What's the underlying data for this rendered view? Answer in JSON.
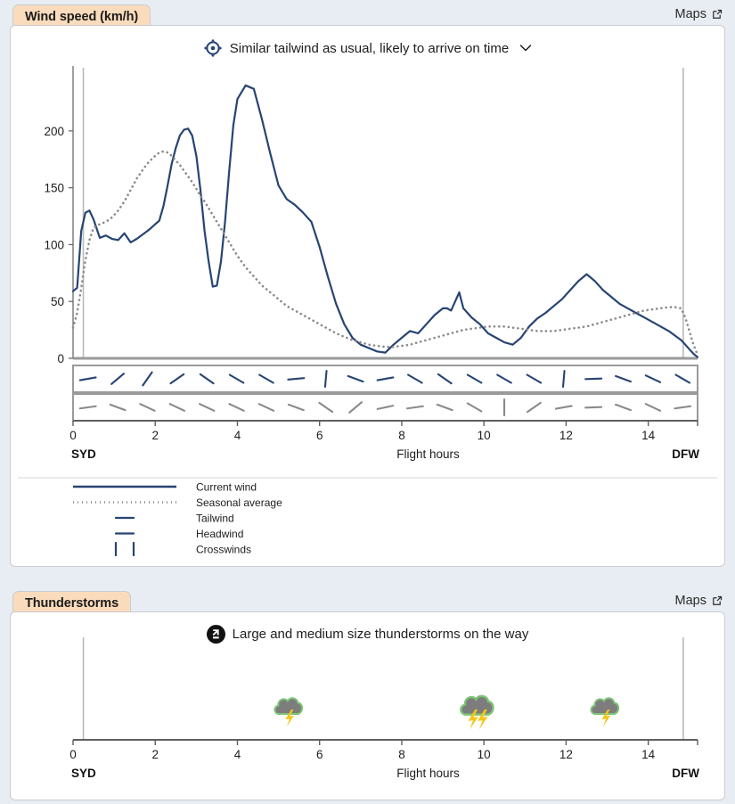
{
  "theme": {
    "page_bg": "#e8edf3",
    "panel_bg": "#ffffff",
    "tab_bg": "#fadcbc",
    "border": "#c9ccd1",
    "series_color": "#274472",
    "seasonal_color": "#8a8a8a",
    "axis_color": "#8c8c8c",
    "storm_cloud": "#7d7d7d",
    "storm_outline": "#7cc576",
    "storm_bolt": "#f5c518"
  },
  "wind_panel": {
    "tab_label": "Wind speed (km/h)",
    "maps_label": "Maps",
    "maps_icon": "external-link-icon",
    "headline_icon": "crosshair-target-icon",
    "headline": "Similar tailwind as usual, likely to arrive on time",
    "chevron_icon": "chevron-down-icon",
    "legend": [
      {
        "label": "Current wind",
        "style": "solid-line",
        "color": "#274472"
      },
      {
        "label": "Seasonal average",
        "style": "dotted-line",
        "color": "#8a8a8a"
      },
      {
        "label": "Tailwind",
        "style": "short-dash",
        "color": "#274472"
      },
      {
        "label": "Headwind",
        "style": "short-dash",
        "color": "#274472"
      },
      {
        "label": "Crosswinds",
        "style": "double-bar",
        "color": "#274472"
      }
    ]
  },
  "storm_panel": {
    "tab_label": "Thunderstorms",
    "maps_label": "Maps",
    "maps_icon": "external-link-icon",
    "headline_icon": "storm-alert-badge-icon",
    "headline": "Large and medium size thunderstorms on the way"
  },
  "chart_data": {
    "type": "line",
    "title": "Wind speed (km/h)",
    "xlabel": "Flight hours",
    "ylabel": "",
    "xlim": [
      0,
      15.2
    ],
    "ylim": [
      0,
      243
    ],
    "xticks": [
      0,
      2,
      4,
      6,
      8,
      10,
      12,
      14
    ],
    "yticks": [
      0,
      50,
      100,
      150,
      200
    ],
    "grid": false,
    "legend_position": "below",
    "origin_label": "SYD",
    "destination_label": "DFW",
    "departure_marker_x": 0.25,
    "arrival_marker_x": 14.85,
    "x": [
      0.0,
      0.1,
      0.2,
      0.3,
      0.4,
      0.5,
      0.65,
      0.8,
      0.95,
      1.1,
      1.25,
      1.4,
      1.55,
      1.7,
      1.85,
      2.0,
      2.1,
      2.2,
      2.3,
      2.4,
      2.5,
      2.6,
      2.7,
      2.8,
      2.9,
      3.0,
      3.1,
      3.2,
      3.3,
      3.4,
      3.5,
      3.6,
      3.7,
      3.8,
      3.9,
      4.0,
      4.2,
      4.4,
      4.6,
      4.8,
      5.0,
      5.2,
      5.4,
      5.6,
      5.8,
      6.0,
      6.2,
      6.4,
      6.6,
      6.8,
      7.0,
      7.2,
      7.4,
      7.6,
      7.8,
      8.0,
      8.2,
      8.4,
      8.6,
      8.8,
      9.0,
      9.1,
      9.2,
      9.3,
      9.4,
      9.5,
      9.7,
      9.9,
      10.1,
      10.3,
      10.5,
      10.7,
      10.9,
      11.1,
      11.3,
      11.5,
      11.7,
      11.9,
      12.1,
      12.3,
      12.5,
      12.7,
      12.9,
      13.1,
      13.3,
      13.5,
      13.7,
      13.9,
      14.1,
      14.3,
      14.5,
      14.65,
      14.8,
      14.9,
      15.0,
      15.1,
      15.2
    ],
    "series": [
      {
        "name": "Current wind",
        "style": "solid",
        "color": "#274472",
        "values": [
          59,
          62,
          112,
          128,
          130,
          122,
          106,
          108,
          105,
          104,
          110,
          102,
          105,
          109,
          113,
          118,
          121,
          134,
          152,
          171,
          185,
          196,
          201,
          202,
          196,
          178,
          148,
          112,
          85,
          63,
          64,
          85,
          120,
          165,
          205,
          228,
          240,
          237,
          210,
          180,
          152,
          140,
          135,
          128,
          120,
          98,
          72,
          48,
          30,
          18,
          12,
          9,
          6,
          5,
          12,
          18,
          24,
          22,
          30,
          38,
          44,
          44,
          42,
          50,
          58,
          44,
          36,
          30,
          22,
          18,
          14,
          12,
          18,
          28,
          35,
          40,
          46,
          52,
          60,
          68,
          74,
          68,
          60,
          54,
          48,
          44,
          40,
          36,
          32,
          28,
          24,
          20,
          16,
          12,
          8,
          4,
          1
        ]
      },
      {
        "name": "Seasonal average",
        "style": "dotted",
        "color": "#8a8a8a",
        "values": [
          27,
          40,
          62,
          86,
          104,
          115,
          118,
          120,
          124,
          130,
          138,
          148,
          158,
          166,
          173,
          178,
          181,
          182,
          181,
          178,
          174,
          170,
          165,
          160,
          155,
          149,
          143,
          138,
          132,
          126,
          120,
          114,
          108,
          102,
          96,
          90,
          80,
          72,
          64,
          58,
          52,
          46,
          42,
          38,
          34,
          30,
          26,
          22,
          19,
          16,
          14,
          12,
          11,
          10,
          10,
          11,
          12,
          14,
          16,
          18,
          20,
          21,
          22,
          23,
          24,
          25,
          26,
          27,
          28,
          28,
          28,
          27,
          26,
          25,
          24,
          24,
          24,
          25,
          26,
          27,
          28,
          30,
          32,
          34,
          36,
          38,
          40,
          42,
          43,
          44,
          45,
          45,
          44,
          36,
          24,
          12,
          3
        ]
      }
    ],
    "wind_barbs_tailwind_row": {
      "name": "Tailwind / Headwind row",
      "color": "#274472",
      "count": 21,
      "angles_deg": [
        170,
        140,
        125,
        145,
        35,
        30,
        30,
        175,
        95,
        20,
        170,
        30,
        35,
        30,
        30,
        30,
        95,
        178,
        20,
        25,
        30
      ]
    },
    "wind_barbs_crosswind_row": {
      "name": "Crosswinds row",
      "color": "#8a8a8a",
      "count": 21,
      "angles_deg": [
        172,
        20,
        25,
        25,
        25,
        25,
        25,
        20,
        35,
        140,
        168,
        172,
        20,
        30,
        90,
        145,
        170,
        178,
        20,
        25
      ]
    }
  },
  "storm_chart_data": {
    "type": "scatter",
    "xlabel": "Flight hours",
    "xlim": [
      0,
      15.2
    ],
    "xticks": [
      0,
      2,
      4,
      6,
      8,
      10,
      12,
      14
    ],
    "origin_label": "SYD",
    "destination_label": "DFW",
    "departure_marker_x": 0.25,
    "arrival_marker_x": 14.85,
    "storms": [
      {
        "x": 5.3,
        "size": "medium",
        "bolts": 1
      },
      {
        "x": 9.9,
        "size": "large",
        "bolts": 2
      },
      {
        "x": 13.0,
        "size": "medium",
        "bolts": 1
      }
    ]
  }
}
